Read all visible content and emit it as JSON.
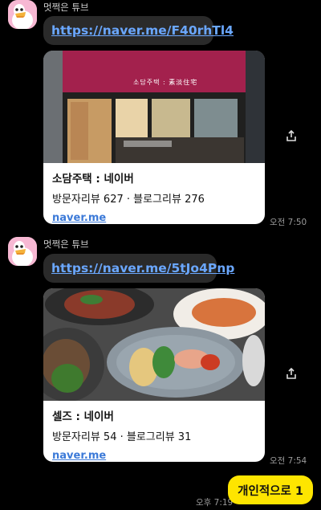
{
  "messages": [
    {
      "sender": "멋쩍은 튜브",
      "link": "https://naver.me/F40rhTl4",
      "card": {
        "title": "소담주택 : 네이버",
        "description": "방문자리뷰 627 · 블로그리뷰 276",
        "domain": "naver.me",
        "sign_text": "소담주택 : 素淡住宅"
      },
      "time": "오전 7:50"
    },
    {
      "sender": "멋쩍은 튜브",
      "link": "https://naver.me/5tJo4Pnp",
      "card": {
        "title": "셀즈 : 네이버",
        "description": "방문자리뷰 54 · 블로그리뷰 31",
        "domain": "naver.me"
      },
      "time": "오전 7:54"
    }
  ],
  "my_message": {
    "text": "개인적으로 1",
    "time": "오후 7:19"
  },
  "colors": {
    "background": "#000000",
    "link": "#6aa7ff",
    "my_bubble": "#fee500",
    "avatar": "#f7b8d3"
  }
}
